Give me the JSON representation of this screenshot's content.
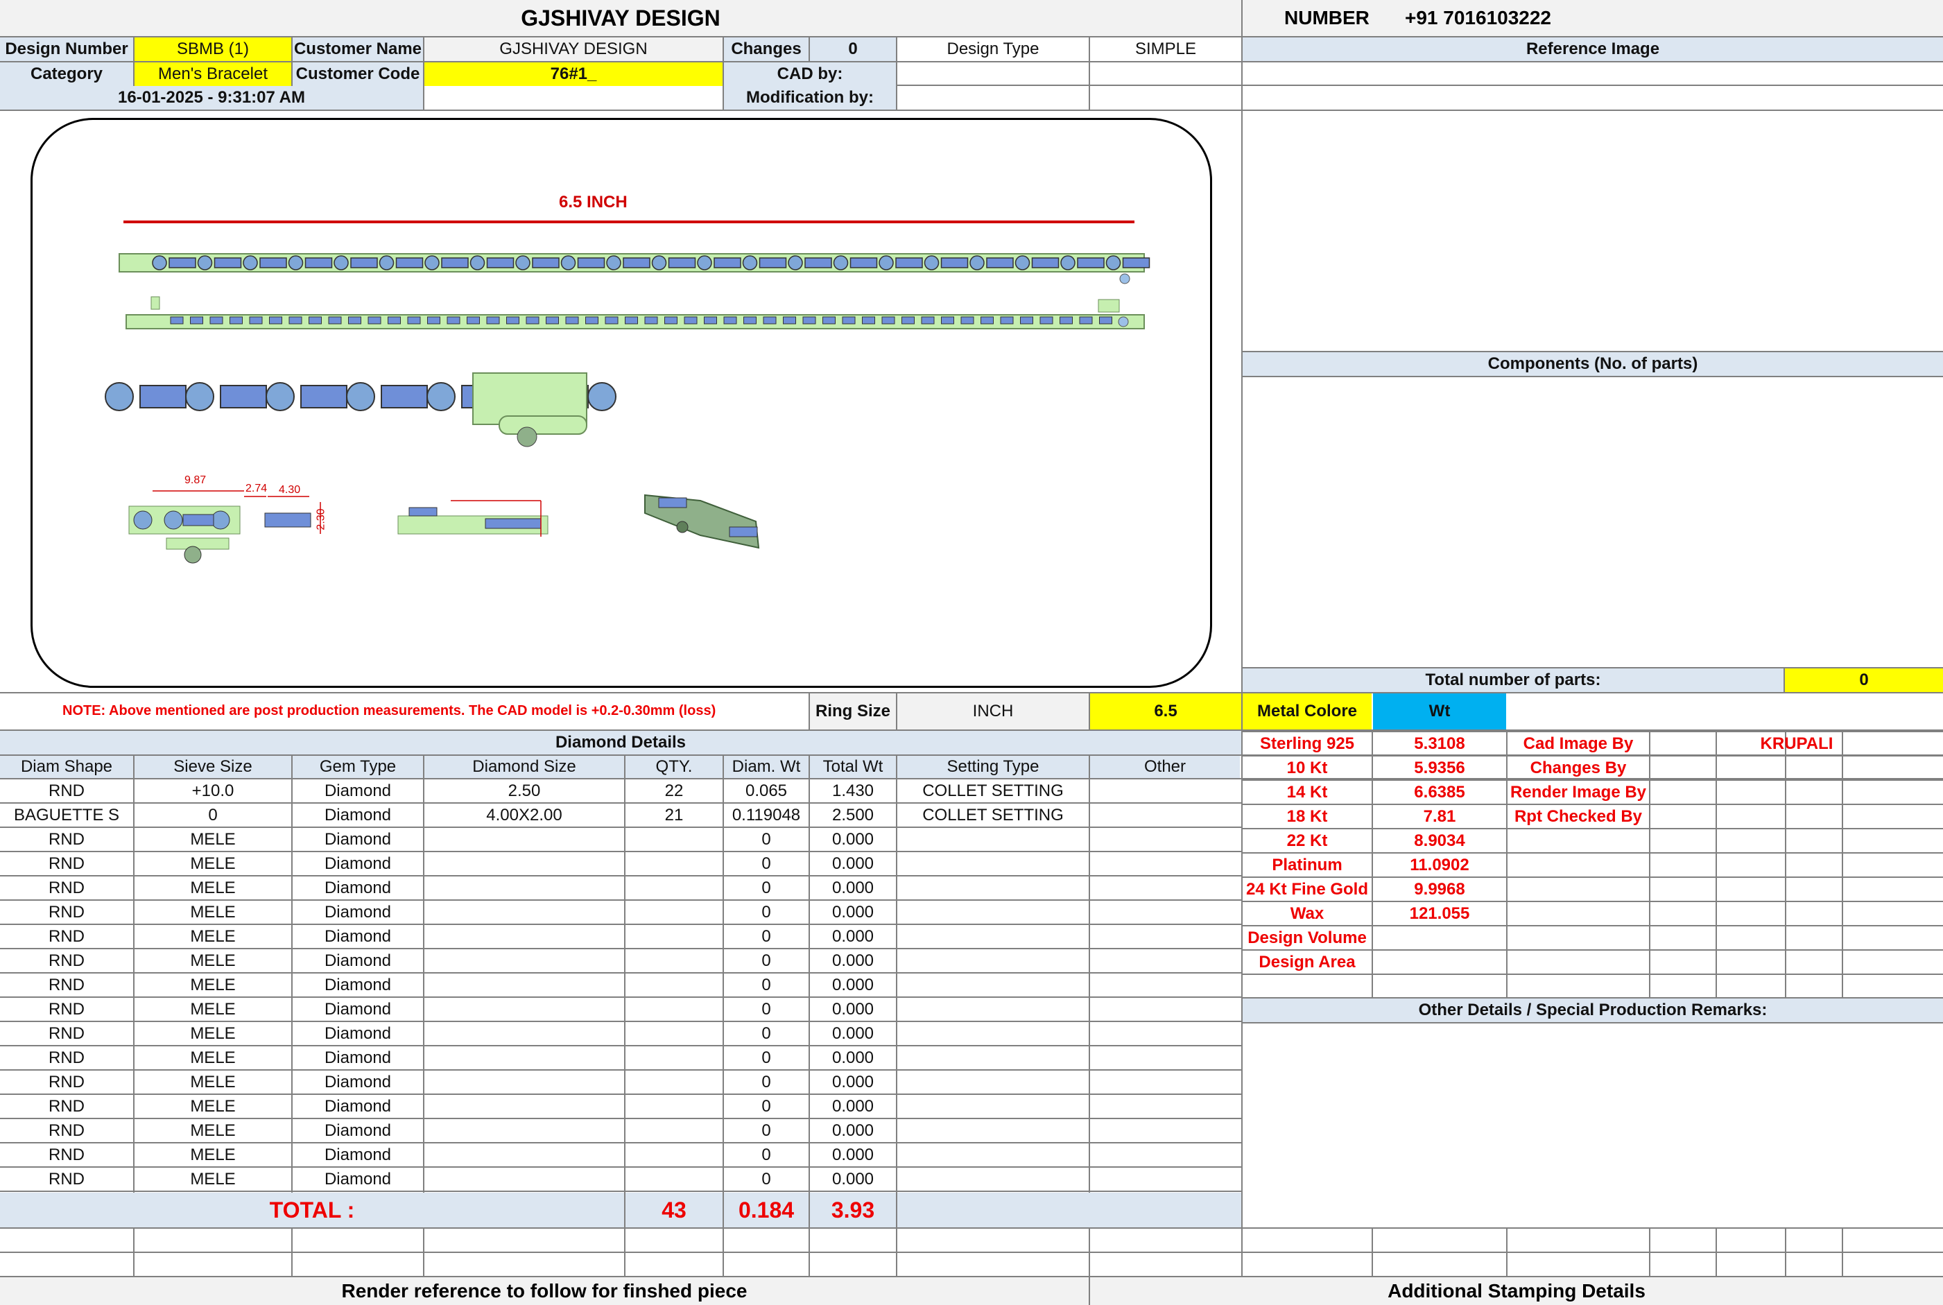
{
  "header": {
    "company_title": "GJSHIVAY DESIGN",
    "number_label": "NUMBER",
    "phone": "+91 7016103222"
  },
  "info": {
    "design_number_label": "Design Number",
    "design_number": "SBMB (1)",
    "customer_name_label": "Customer Name",
    "customer_name": "GJSHIVAY DESIGN",
    "changes_label": "Changes",
    "changes_value": "0",
    "design_type_label": "Design Type",
    "design_type_value": "SIMPLE",
    "category_label": "Category",
    "category_value": "Men's Bracelet",
    "customer_code_label": "Customer Code",
    "customer_code_value": "76#1_",
    "cad_by_label": "CAD by:",
    "timestamp": "16-01-2025 - 9:31:07 AM",
    "modification_by_label": "Modification by:"
  },
  "drawing": {
    "length_label": "6.5 INCH",
    "dim_a": "9.87",
    "dim_b": "2.74",
    "dim_c": "4.30",
    "dim_d": "2.30"
  },
  "right_panel": {
    "reference_image_label": "Reference Image",
    "components_label": "Components (No. of parts)",
    "total_parts_label": "Total number of parts:",
    "total_parts_value": "0",
    "other_details_label": "Other Details / Special Production Remarks:",
    "additional_stamping_label": "Additional Stamping Details"
  },
  "note": {
    "text": "NOTE: Above mentioned are post production measurements. The CAD model is +0.2-0.30mm (loss)",
    "ring_size_label": "Ring Size",
    "ring_size_unit": "INCH",
    "ring_size_value": "6.5"
  },
  "diamond": {
    "title": "Diamond Details",
    "headers": [
      "Diam Shape",
      "Sieve Size",
      "Gem Type",
      "Diamond Size",
      "QTY.",
      "Diam. Wt",
      "Total Wt",
      "Setting Type",
      "Other"
    ],
    "rows": [
      [
        "RND",
        "+10.0",
        "Diamond",
        "2.50",
        "22",
        "0.065",
        "1.430",
        "COLLET SETTING",
        ""
      ],
      [
        "BAGUETTE S",
        "0",
        "Diamond",
        "4.00X2.00",
        "21",
        "0.119048",
        "2.500",
        "COLLET SETTING",
        ""
      ],
      [
        "RND",
        "MELE",
        "Diamond",
        "",
        "",
        "0",
        "0.000",
        "",
        ""
      ],
      [
        "RND",
        "MELE",
        "Diamond",
        "",
        "",
        "0",
        "0.000",
        "",
        ""
      ],
      [
        "RND",
        "MELE",
        "Diamond",
        "",
        "",
        "0",
        "0.000",
        "",
        ""
      ],
      [
        "RND",
        "MELE",
        "Diamond",
        "",
        "",
        "0",
        "0.000",
        "",
        ""
      ],
      [
        "RND",
        "MELE",
        "Diamond",
        "",
        "",
        "0",
        "0.000",
        "",
        ""
      ],
      [
        "RND",
        "MELE",
        "Diamond",
        "",
        "",
        "0",
        "0.000",
        "",
        ""
      ],
      [
        "RND",
        "MELE",
        "Diamond",
        "",
        "",
        "0",
        "0.000",
        "",
        ""
      ],
      [
        "RND",
        "MELE",
        "Diamond",
        "",
        "",
        "0",
        "0.000",
        "",
        ""
      ],
      [
        "RND",
        "MELE",
        "Diamond",
        "",
        "",
        "0",
        "0.000",
        "",
        ""
      ],
      [
        "RND",
        "MELE",
        "Diamond",
        "",
        "",
        "0",
        "0.000",
        "",
        ""
      ],
      [
        "RND",
        "MELE",
        "Diamond",
        "",
        "",
        "0",
        "0.000",
        "",
        ""
      ],
      [
        "RND",
        "MELE",
        "Diamond",
        "",
        "",
        "0",
        "0.000",
        "",
        ""
      ],
      [
        "RND",
        "MELE",
        "Diamond",
        "",
        "",
        "0",
        "0.000",
        "",
        ""
      ],
      [
        "RND",
        "MELE",
        "Diamond",
        "",
        "",
        "0",
        "0.000",
        "",
        ""
      ],
      [
        "RND",
        "MELE",
        "Diamond",
        "",
        "",
        "0",
        "0.000",
        "",
        ""
      ]
    ],
    "total_label": "TOTAL :",
    "total_qty": "43",
    "total_diam_wt": "0.184",
    "total_wt": "3.93"
  },
  "metal": {
    "color_label": "Metal Colore",
    "wt_label": "Wt",
    "rows": [
      {
        "name": "Sterling 925",
        "wt": "5.3108"
      },
      {
        "name": "10 Kt",
        "wt": "5.9356"
      },
      {
        "name": "14 Kt",
        "wt": "6.6385"
      },
      {
        "name": "18 Kt",
        "wt": "7.81"
      },
      {
        "name": "22 Kt",
        "wt": "8.9034"
      },
      {
        "name": "Platinum",
        "wt": "11.0902"
      },
      {
        "name": "24 Kt Fine Gold",
        "wt": "9.9968"
      },
      {
        "name": "Wax",
        "wt": "121.055"
      },
      {
        "name": "Design Volume",
        "wt": ""
      },
      {
        "name": "Design Area",
        "wt": ""
      }
    ]
  },
  "credits": [
    {
      "label": "Cad Image By",
      "value": "KRUPALI"
    },
    {
      "label": "Changes By",
      "value": ""
    },
    {
      "label": "Render Image By",
      "value": ""
    },
    {
      "label": "Rpt Checked By",
      "value": ""
    }
  ],
  "footer": {
    "render_reference_label": "Render reference to follow for finshed piece"
  }
}
